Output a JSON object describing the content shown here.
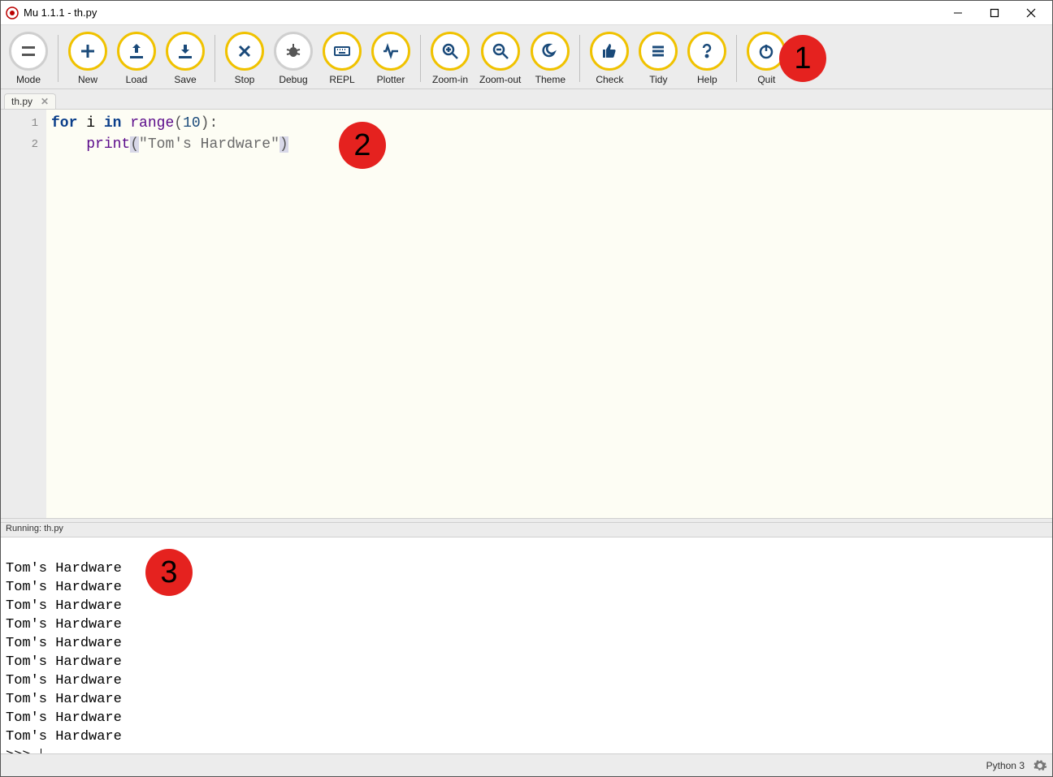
{
  "window": {
    "title": "Mu 1.1.1 - th.py"
  },
  "toolbar": {
    "mode": "Mode",
    "new": "New",
    "load": "Load",
    "save": "Save",
    "stop": "Stop",
    "debug": "Debug",
    "repl": "REPL",
    "plotter": "Plotter",
    "zoom_in": "Zoom-in",
    "zoom_out": "Zoom-out",
    "theme": "Theme",
    "check": "Check",
    "tidy": "Tidy",
    "help": "Help",
    "quit": "Quit"
  },
  "tabs": {
    "file_name": "th.py"
  },
  "editor": {
    "gutter": [
      "1",
      "2"
    ],
    "line1": {
      "kw_for": "for",
      "var": " i ",
      "kw_in": "in",
      "space": " ",
      "fn_range": "range",
      "lp": "(",
      "num": "10",
      "rp": ")",
      "colon": ":"
    },
    "line2": {
      "indent": "    ",
      "fn_print": "print",
      "lp": "(",
      "str": "\"Tom's Hardware\"",
      "rp": ")"
    }
  },
  "output": {
    "header": "Running: th.py",
    "lines": [
      "Tom's Hardware",
      "Tom's Hardware",
      "Tom's Hardware",
      "Tom's Hardware",
      "Tom's Hardware",
      "Tom's Hardware",
      "Tom's Hardware",
      "Tom's Hardware",
      "Tom's Hardware",
      "Tom's Hardware"
    ],
    "prompt": ">>> "
  },
  "status": {
    "mode_label": "Python 3"
  },
  "callouts": {
    "one": "1",
    "two": "2",
    "three": "3"
  }
}
